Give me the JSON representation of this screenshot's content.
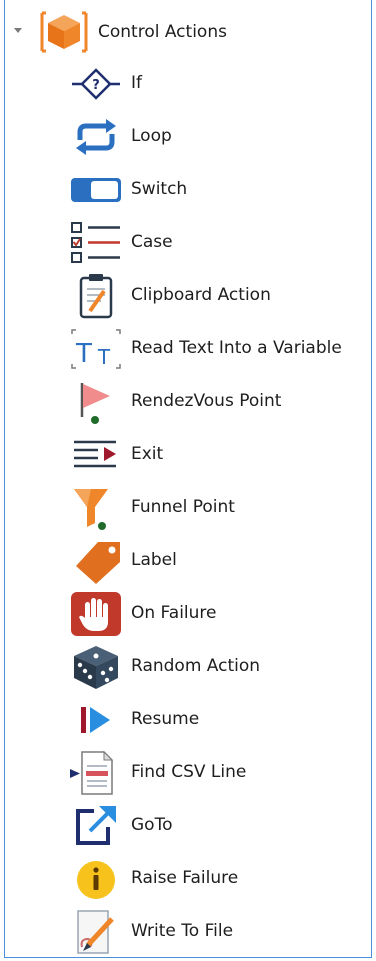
{
  "tree": {
    "root": {
      "label": "Control Actions",
      "icon": "box-icon",
      "expanded": true
    },
    "items": [
      {
        "label": "If",
        "icon": "if-diamond-icon"
      },
      {
        "label": "Loop",
        "icon": "loop-icon"
      },
      {
        "label": "Switch",
        "icon": "switch-toggle-icon"
      },
      {
        "label": "Case",
        "icon": "case-list-icon"
      },
      {
        "label": "Clipboard Action",
        "icon": "clipboard-icon"
      },
      {
        "label": "Read Text Into a Variable",
        "icon": "read-text-icon"
      },
      {
        "label": "RendezVous Point",
        "icon": "flag-icon"
      },
      {
        "label": "Exit",
        "icon": "exit-icon"
      },
      {
        "label": "Funnel Point",
        "icon": "funnel-icon"
      },
      {
        "label": "Label",
        "icon": "tag-icon"
      },
      {
        "label": "On Failure",
        "icon": "hand-stop-icon"
      },
      {
        "label": "Random Action",
        "icon": "dice-icon"
      },
      {
        "label": "Resume",
        "icon": "resume-icon"
      },
      {
        "label": "Find CSV Line",
        "icon": "csv-document-icon"
      },
      {
        "label": "GoTo",
        "icon": "goto-arrow-icon"
      },
      {
        "label": "Raise Failure",
        "icon": "info-circle-icon"
      },
      {
        "label": "Write To File",
        "icon": "write-file-icon"
      }
    ]
  },
  "colors": {
    "border_accent": "#4a90d9",
    "orange": "#f0862a",
    "blue": "#2a6fc0",
    "red": "#c0392b",
    "navy": "#1f2e6e",
    "yellow": "#f7c21b",
    "dark": "#2b3a4a"
  }
}
